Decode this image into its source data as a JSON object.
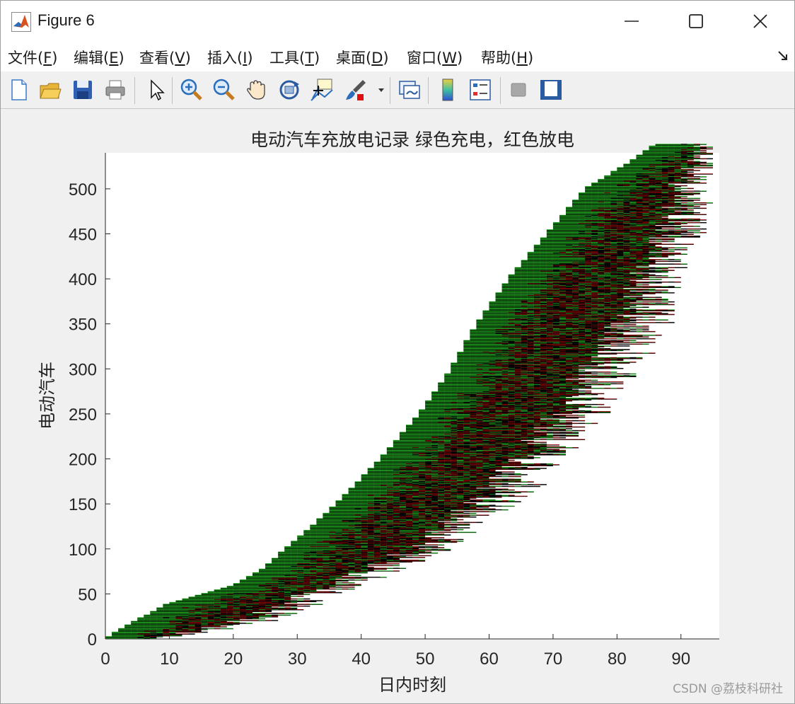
{
  "window": {
    "title": "Figure 6",
    "minimize_label": "—",
    "maximize_label": "☐",
    "close_label": "✕"
  },
  "menu": {
    "items": [
      {
        "text": "文件(",
        "key": "F",
        "end": ")"
      },
      {
        "text": "编辑(",
        "key": "E",
        "end": ")"
      },
      {
        "text": "查看(",
        "key": "V",
        "end": ")"
      },
      {
        "text": "插入(",
        "key": "I",
        "end": ")"
      },
      {
        "text": "工具(",
        "key": "T",
        "end": ")"
      },
      {
        "text": "桌面(",
        "key": "D",
        "end": ")"
      },
      {
        "text": "窗口(",
        "key": "W",
        "end": ")"
      },
      {
        "text": "帮助(",
        "key": "H",
        "end": ")"
      }
    ]
  },
  "toolbar": {
    "icons": [
      "new-figure-icon",
      "open-file-icon",
      "save-icon",
      "print-icon",
      "edit-plot-arrow-icon",
      "zoom-in-icon",
      "zoom-out-icon",
      "pan-hand-icon",
      "rotate-3d-icon",
      "data-cursor-icon",
      "brush-icon",
      "link-plot-icon",
      "colorbar-icon",
      "legend-icon",
      "hide-plot-tools-icon",
      "show-plot-tools-icon"
    ]
  },
  "watermark": "CSDN @荔枝科研社",
  "chart_data": {
    "type": "bar",
    "title": "电动汽车充放电记录  绿色充电，红色放电",
    "xlabel": "日内时刻",
    "ylabel": "电动汽车",
    "xlim": [
      0,
      96
    ],
    "ylim": [
      0,
      540
    ],
    "xticks": [
      0,
      10,
      20,
      30,
      40,
      50,
      60,
      70,
      80,
      90
    ],
    "yticks": [
      0,
      50,
      100,
      150,
      200,
      250,
      300,
      350,
      400,
      450,
      500
    ],
    "vehicle_count": 550,
    "colors": {
      "charge": "#1db41d",
      "discharge": "#8b0000",
      "outline": "#000000"
    },
    "start_profile": [
      {
        "vehicle": 0,
        "start": 0
      },
      {
        "vehicle": 10,
        "start": 2
      },
      {
        "vehicle": 25,
        "start": 6
      },
      {
        "vehicle": 40,
        "start": 10
      },
      {
        "vehicle": 50,
        "start": 15
      },
      {
        "vehicle": 60,
        "start": 20
      },
      {
        "vehicle": 80,
        "start": 25
      },
      {
        "vehicle": 100,
        "start": 28
      },
      {
        "vehicle": 130,
        "start": 33
      },
      {
        "vehicle": 150,
        "start": 36
      },
      {
        "vehicle": 200,
        "start": 43
      },
      {
        "vehicle": 250,
        "start": 49
      },
      {
        "vehicle": 300,
        "start": 54
      },
      {
        "vehicle": 350,
        "start": 58
      },
      {
        "vehicle": 400,
        "start": 63
      },
      {
        "vehicle": 450,
        "start": 69
      },
      {
        "vehicle": 500,
        "start": 75
      },
      {
        "vehicle": 530,
        "start": 82
      },
      {
        "vehicle": 550,
        "start": 86
      }
    ],
    "end_profile": [
      {
        "vehicle": 0,
        "end": 10
      },
      {
        "vehicle": 20,
        "end": 28
      },
      {
        "vehicle": 50,
        "end": 38
      },
      {
        "vehicle": 100,
        "end": 55
      },
      {
        "vehicle": 150,
        "end": 66
      },
      {
        "vehicle": 200,
        "end": 73
      },
      {
        "vehicle": 250,
        "end": 79
      },
      {
        "vehicle": 300,
        "end": 84
      },
      {
        "vehicle": 350,
        "end": 89
      },
      {
        "vehicle": 400,
        "end": 91
      },
      {
        "vehicle": 450,
        "end": 94
      },
      {
        "vehicle": 500,
        "end": 95
      },
      {
        "vehicle": 550,
        "end": 96
      }
    ]
  }
}
